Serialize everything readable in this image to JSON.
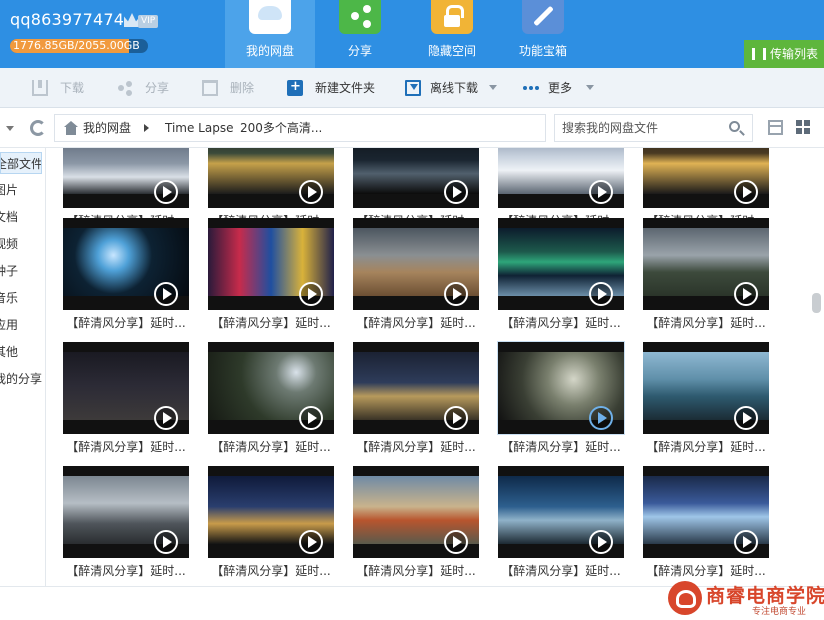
{
  "header": {
    "username": "qq863977474",
    "vip_label": "VIP",
    "quota_text": "1776.85GB/2055.00GB",
    "quota_used_fraction": 0.865,
    "tabs": [
      {
        "label": "我的网盘",
        "icon": "cloud-drive-icon"
      },
      {
        "label": "分享",
        "icon": "share-icon"
      },
      {
        "label": "隐藏空间",
        "icon": "lock-icon"
      },
      {
        "label": "功能宝箱",
        "icon": "wrench-icon"
      }
    ],
    "transfer_list_label": "传输列表"
  },
  "toolbar": {
    "download": "下载",
    "share": "分享",
    "delete": "删除",
    "new_folder": "新建文件夹",
    "offline_download": "离线下载",
    "more": "更多"
  },
  "address": {
    "crumbs": [
      "我的网盘",
      "Time Lapse",
      "200多个高清..."
    ],
    "search_placeholder": "搜索我的网盘文件"
  },
  "sidebar": {
    "items": [
      "全部文件",
      "图片",
      "文档",
      "视频",
      "种子",
      "音乐",
      "应用",
      "其他",
      "我的分享"
    ]
  },
  "files": {
    "rows": [
      [
        "【醉清风分享】延时...",
        "【醉清风分享】延时...",
        "【醉清风分享】延时...",
        "【醉清风分享】延时...",
        "【醉清风分享】延时..."
      ],
      [
        "【醉清风分享】延时...",
        "【醉清风分享】延时...",
        "【醉清风分享】延时...",
        "【醉清风分享】延时...",
        "【醉清风分享】延时..."
      ],
      [
        "【醉清风分享】延时...",
        "【醉清风分享】延时...",
        "【醉清风分享】延时...",
        "【醉清风分享】延时...",
        "【醉清风分享】延时..."
      ],
      [
        "【醉清风分享】延时...",
        "【醉清风分享】延时...",
        "【醉清风分享】延时...",
        "【醉清风分享】延时...",
        "【醉清风分享】延时..."
      ]
    ]
  },
  "watermark": {
    "brand": "商睿电商学院",
    "sub": "专注电商专业"
  },
  "colors": {
    "header_bg": "#2e8fe3",
    "active_tab": "#4ca3ea",
    "transfer_button": "#5eb63c",
    "quota_fill": "#f19a3e",
    "watermark": "#d8462b"
  }
}
